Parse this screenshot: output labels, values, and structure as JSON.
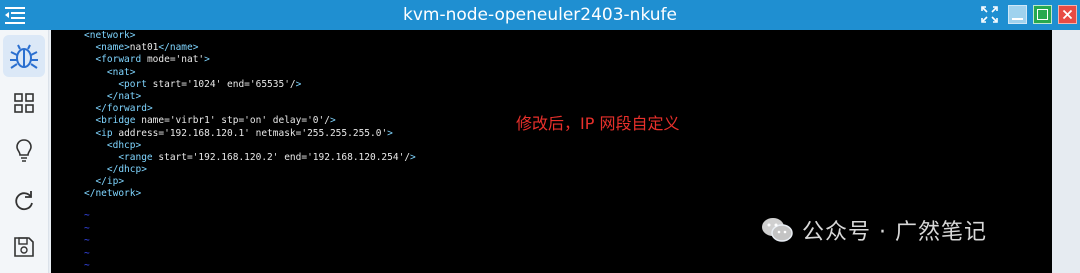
{
  "window": {
    "title": "kvm-node-openeuler2403-nkufe"
  },
  "sidebar": {
    "items": [
      {
        "name": "bug-icon",
        "active": true
      },
      {
        "name": "grid-icon"
      },
      {
        "name": "lightbulb-icon"
      },
      {
        "name": "refresh-icon"
      },
      {
        "name": "save-icon"
      }
    ]
  },
  "terminal": {
    "lines": [
      "<network>",
      "  <name>nat01</name>",
      "  <forward mode='nat'>",
      "    <nat>",
      "      <port start='1024' end='65535'/>",
      "    </nat>",
      "  </forward>",
      "  <bridge name='virbr1' stp='on' delay='0'/>",
      "  <ip address='192.168.120.1' netmask='255.255.255.0'>",
      "    <dhcp>",
      "      <range start='192.168.120.2' end='192.168.120.254'/>",
      "    </dhcp>",
      "  </ip>",
      "</network>"
    ],
    "empty_line_marker": "~",
    "annotation": "修改后，IP 网段自定义"
  },
  "watermark": {
    "text": "公众号 · 广然笔记"
  },
  "colors": {
    "titlebar": "#1f8fd1",
    "terminal_bg": "#000000",
    "tag": "#7fd5ff",
    "attr": "#7fe08a",
    "value": "#ff7be5",
    "annotation": "#e8302b",
    "tilde": "#3a4dff"
  }
}
